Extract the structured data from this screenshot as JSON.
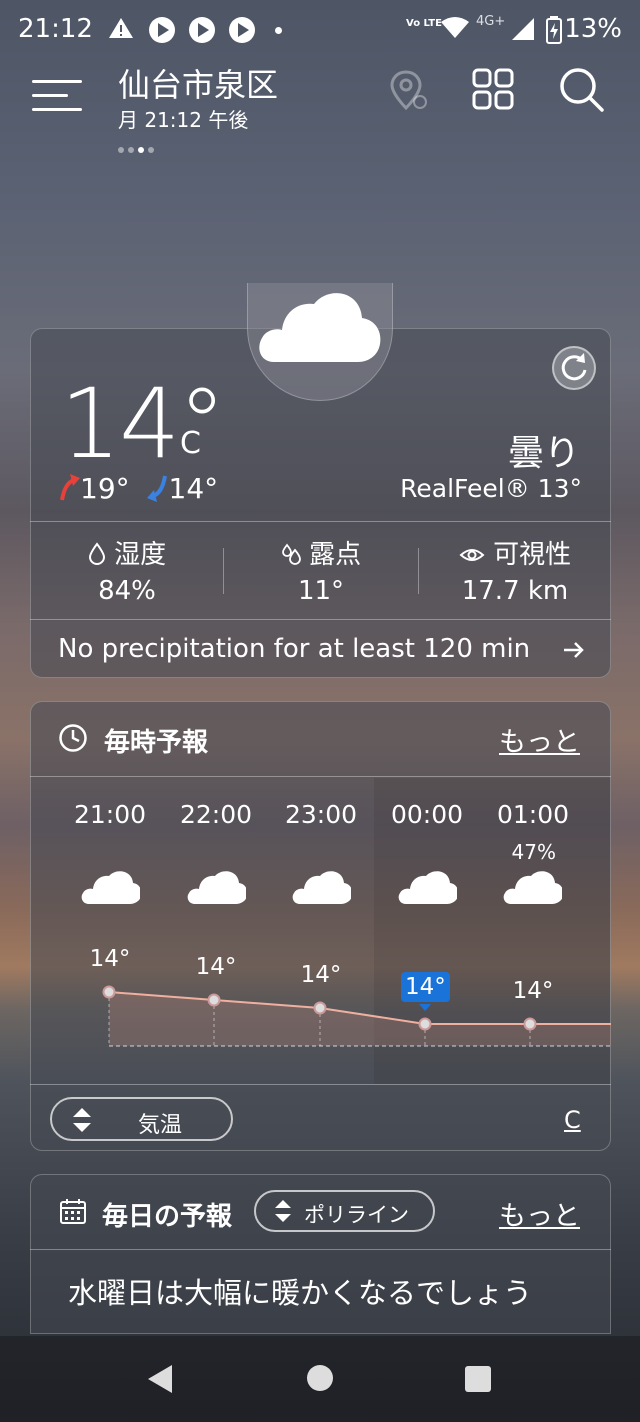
{
  "status_bar": {
    "time": "21:12",
    "network": "4G+",
    "volte": "Vo LTE",
    "battery": "13%"
  },
  "header": {
    "city": "仙台市泉区",
    "datetime": "月 21:12 午後"
  },
  "current": {
    "temperature": "14°",
    "unit": "C",
    "high": "19°",
    "low": "14°",
    "condition": "曇り",
    "realfeel": "RealFeel® 13°",
    "metrics": [
      {
        "label": "湿度",
        "value": "84%",
        "icon": "droplet-icon"
      },
      {
        "label": "露点",
        "value": "11°",
        "icon": "dew-icon"
      },
      {
        "label": "可視性",
        "value": "17.7 km",
        "icon": "eye-icon"
      }
    ],
    "precipitation": "No precipitation for at least 120 min",
    "colors": {
      "high_arrow": "#e8413a",
      "low_arrow": "#3b82e0"
    }
  },
  "hourly": {
    "title": "毎時予報",
    "more": "もっと",
    "hours": [
      {
        "time": "21:00",
        "temp": "14°",
        "precip": ""
      },
      {
        "time": "22:00",
        "temp": "14°",
        "precip": ""
      },
      {
        "time": "23:00",
        "temp": "14°",
        "precip": ""
      },
      {
        "time": "00:00",
        "temp": "14°",
        "precip": ""
      },
      {
        "time": "01:00",
        "temp": "14°",
        "precip": "47%"
      }
    ],
    "selected_index": 3,
    "selected_color": "#1a73d9",
    "metric_toggle": "気温",
    "unit": "C"
  },
  "daily": {
    "title": "毎日の予報",
    "view_toggle": "ポリライン",
    "more": "もっと",
    "headline": "水曜日は大幅に暖かくなるでしょう"
  }
}
